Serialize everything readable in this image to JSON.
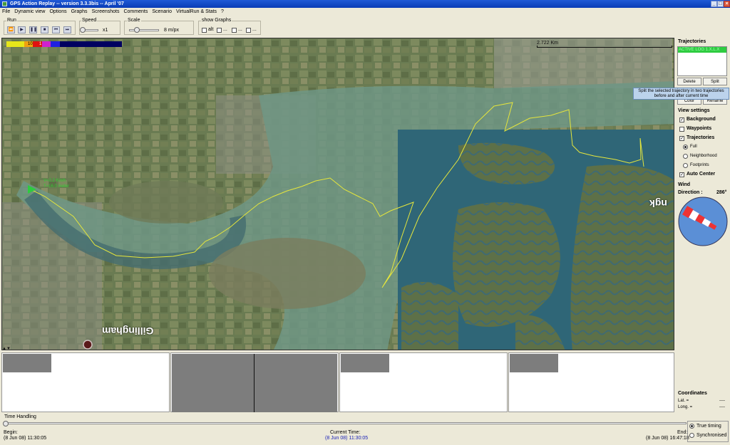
{
  "window": {
    "title": "GPS Action Replay -- version 3.3.3bis -- April '07",
    "controls": [
      "_",
      "□",
      "×"
    ]
  },
  "menu": [
    "File",
    "Dynamic view",
    "Options",
    "Graphs",
    "Screenshots",
    "Comments",
    "Scenario",
    "VirtualRun & Stats",
    "?"
  ],
  "toolbar": {
    "run_label": "Run",
    "speed_label": "Speed",
    "speed_value": "x1",
    "speed_level": 0.1,
    "scale_label": "Scale",
    "scale_value": "8 m/px",
    "scale_level": 0.25,
    "graphs_label": "show Graphs",
    "graph_options": [
      "alt",
      "...",
      "...",
      "..."
    ]
  },
  "map": {
    "scale_text": "2.722 Km",
    "legend_values": [
      "10",
      "1"
    ],
    "track_label_1": "V=2.2 Km/h",
    "track_label_2": "T=16.0 meter",
    "place_gillingham": "Gillingham",
    "place_right": "ngk",
    "colors": {
      "track": "#e6e63c",
      "water": "#4b7f8c",
      "land": "#6b7a55"
    }
  },
  "trajectories": {
    "title": "Trajectories",
    "list": [
      "ACTIVE LOG 1.X.L.X"
    ],
    "delete_label": "Delete",
    "split_label": "Split",
    "color_label": "Color",
    "rename_label": "Rename",
    "tooltip": "Split the selected trajectory in two trajectories before and after current time"
  },
  "view_settings": {
    "title": "View settings",
    "background": "Background",
    "waypoints": "Waypoints",
    "trajectories": "Trajectories",
    "full": "Full",
    "neighborhood": "Neighborhood",
    "footprints": "Footprints",
    "auto_center": "Auto Center"
  },
  "wind": {
    "title": "Wind",
    "direction_label": "Direction :",
    "direction_value": "286°"
  },
  "coordinates": {
    "title": "Coordinates",
    "lat_label": "Lat. =",
    "lat_value": "----",
    "long_label": "Long. =",
    "long_value": "----"
  },
  "time": {
    "title": "Time Handling",
    "begin_label": "Begin:",
    "begin_value": "(8 Jun 08) 11:30:05",
    "current_label": "Current Time:",
    "current_value": "(8 Jun 08) 11:30:05",
    "end_label": "End:",
    "end_value": "(8 Jun 08) 16:47:18",
    "true_timing": "True timing",
    "synchronised": "Synchronised"
  }
}
